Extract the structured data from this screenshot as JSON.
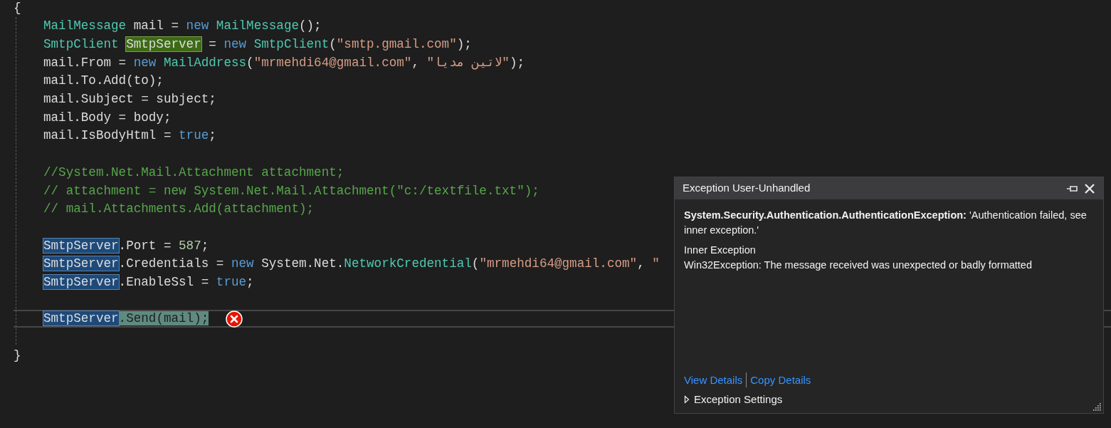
{
  "editor": {
    "block": {
      "open": "{",
      "close": "}",
      "lines": [
        {
          "kind": "code",
          "tokens": [
            {
              "text": "MailMessage",
              "kind": "type"
            },
            {
              "text": " mail = ",
              "kind": "plain"
            },
            {
              "text": "new",
              "kind": "keyword"
            },
            {
              "text": " MailMessage",
              "kind": "type"
            },
            {
              "text": "();",
              "kind": "plain"
            }
          ]
        },
        {
          "kind": "code",
          "tokens": [
            {
              "text": "SmtpClient ",
              "kind": "type"
            },
            {
              "text": "SmtpServer",
              "kind": "definition"
            },
            {
              "text": " = ",
              "kind": "plain"
            },
            {
              "text": "new",
              "kind": "keyword"
            },
            {
              "text": " SmtpClient",
              "kind": "type"
            },
            {
              "text": "(",
              "kind": "plain"
            },
            {
              "text": "\"smtp.gmail.com\"",
              "kind": "string"
            },
            {
              "text": ");",
              "kind": "plain"
            }
          ]
        },
        {
          "kind": "code",
          "tokens": [
            {
              "text": "mail.From = ",
              "kind": "plain"
            },
            {
              "text": "new",
              "kind": "keyword"
            },
            {
              "text": " MailAddress",
              "kind": "type"
            },
            {
              "text": "(",
              "kind": "plain"
            },
            {
              "text": "\"mrmehdi64@gmail.com\"",
              "kind": "string"
            },
            {
              "text": ", ",
              "kind": "plain"
            },
            {
              "text": "\"",
              "kind": "string"
            },
            {
              "text": "لاتین مدیا",
              "kind": "string"
            },
            {
              "text": "\"",
              "kind": "string"
            },
            {
              "text": ");",
              "kind": "plain"
            }
          ]
        },
        {
          "kind": "code",
          "tokens": [
            {
              "text": "mail.To.Add(to);",
              "kind": "plain"
            }
          ]
        },
        {
          "kind": "code",
          "tokens": [
            {
              "text": "mail.Subject = subject;",
              "kind": "plain"
            }
          ]
        },
        {
          "kind": "code",
          "tokens": [
            {
              "text": "mail.Body = body;",
              "kind": "plain"
            }
          ]
        },
        {
          "kind": "code",
          "tokens": [
            {
              "text": "mail.IsBodyHtml = ",
              "kind": "plain"
            },
            {
              "text": "true",
              "kind": "keyword"
            },
            {
              "text": ";",
              "kind": "plain"
            }
          ]
        },
        {
          "kind": "blank"
        },
        {
          "kind": "code",
          "tokens": [
            {
              "text": "//System.Net.Mail.Attachment attachment;",
              "kind": "comment"
            }
          ]
        },
        {
          "kind": "code",
          "tokens": [
            {
              "text": "// attachment = new System.Net.Mail.Attachment(\"c:/textfile.txt\");",
              "kind": "comment"
            }
          ]
        },
        {
          "kind": "code",
          "tokens": [
            {
              "text": "// mail.Attachments.Add(attachment);",
              "kind": "comment"
            }
          ]
        },
        {
          "kind": "blank"
        },
        {
          "kind": "code",
          "tokens": [
            {
              "text": "SmtpServer",
              "kind": "reference"
            },
            {
              "text": ".Port = ",
              "kind": "plain"
            },
            {
              "text": "587",
              "kind": "number"
            },
            {
              "text": ";",
              "kind": "plain"
            }
          ]
        },
        {
          "kind": "code",
          "tokens": [
            {
              "text": "SmtpServer",
              "kind": "reference"
            },
            {
              "text": ".Credentials = ",
              "kind": "plain"
            },
            {
              "text": "new",
              "kind": "keyword"
            },
            {
              "text": " System.Net.",
              "kind": "plain"
            },
            {
              "text": "NetworkCredential",
              "kind": "type"
            },
            {
              "text": "(",
              "kind": "plain"
            },
            {
              "text": "\"mrmehdi64@gmail.com\"",
              "kind": "string"
            },
            {
              "text": ", ",
              "kind": "plain"
            },
            {
              "text": "\"",
              "kind": "string"
            }
          ]
        },
        {
          "kind": "code",
          "tokens": [
            {
              "text": "SmtpServer",
              "kind": "reference"
            },
            {
              "text": ".EnableSsl = ",
              "kind": "plain"
            },
            {
              "text": "true",
              "kind": "keyword"
            },
            {
              "text": ";",
              "kind": "plain"
            }
          ]
        },
        {
          "kind": "blank"
        },
        {
          "kind": "code",
          "tokens": [
            {
              "text": "SmtpServer",
              "kind": "reference"
            },
            {
              "text": ".Send(mail);",
              "kind": "statement"
            }
          ],
          "current": true,
          "error": true
        },
        {
          "kind": "blank"
        }
      ]
    }
  },
  "exception_popup": {
    "title": "Exception User-Unhandled",
    "message": "**System.Security.Authentication.AuthenticationException:** 'Authentication failed, see inner exception.'",
    "inner_label": "Inner Exception",
    "inner_message": "Win32Exception: The message received was unexpected or badly formatted",
    "links": [
      "View Details",
      "Copy Details"
    ],
    "settings": {
      "label": "Exception Settings",
      "expanded": false
    }
  }
}
